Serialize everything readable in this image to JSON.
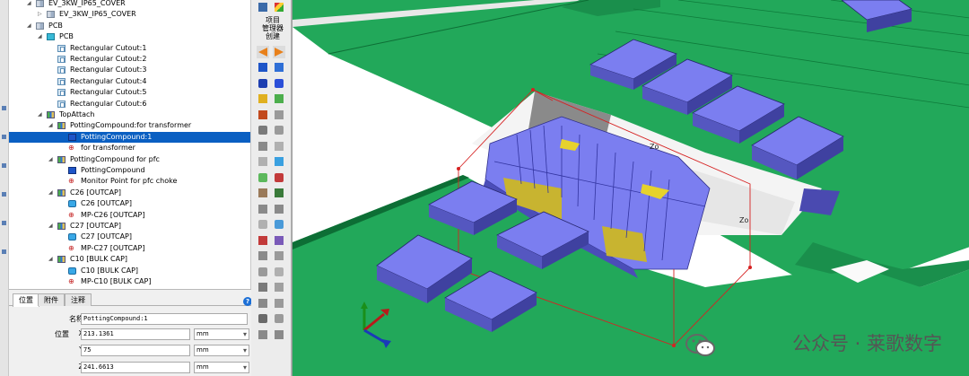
{
  "tree": [
    {
      "label": "EV_3KW_IP65_COVER",
      "indent": 3,
      "tw": "−",
      "icon": "asm",
      "selected": false
    },
    {
      "label": "EV_3KW_IP65_COVER",
      "indent": 4,
      "tw": "+",
      "icon": "asm",
      "selected": false
    },
    {
      "label": "PCB",
      "indent": 3,
      "tw": "−",
      "icon": "asm",
      "selected": false
    },
    {
      "label": "PCB",
      "indent": 4,
      "tw": "−",
      "icon": "pcb",
      "selected": false
    },
    {
      "label": "Rectangular Cutout:1",
      "indent": 5,
      "tw": "",
      "icon": "cut",
      "selected": false
    },
    {
      "label": "Rectangular Cutout:2",
      "indent": 5,
      "tw": "",
      "icon": "cut",
      "selected": false
    },
    {
      "label": "Rectangular Cutout:3",
      "indent": 5,
      "tw": "",
      "icon": "cut",
      "selected": false
    },
    {
      "label": "Rectangular Cutout:4",
      "indent": 5,
      "tw": "",
      "icon": "cut",
      "selected": false
    },
    {
      "label": "Rectangular Cutout:5",
      "indent": 5,
      "tw": "",
      "icon": "cut",
      "selected": false
    },
    {
      "label": "Rectangular Cutout:6",
      "indent": 5,
      "tw": "",
      "icon": "cut",
      "selected": false
    },
    {
      "label": "TopAttach",
      "indent": 4,
      "tw": "−",
      "icon": "grp",
      "selected": false
    },
    {
      "label": "PottingCompound:for transformer",
      "indent": 5,
      "tw": "−",
      "icon": "grp",
      "selected": false
    },
    {
      "label": "PottingCompound:1",
      "indent": 6,
      "tw": "",
      "icon": "pot",
      "selected": true
    },
    {
      "label": "for transformer",
      "indent": 6,
      "tw": "",
      "icon": "mp",
      "selected": false
    },
    {
      "label": "PottingCompound for pfc",
      "indent": 5,
      "tw": "−",
      "icon": "grp",
      "selected": false
    },
    {
      "label": "PottingCompound",
      "indent": 6,
      "tw": "",
      "icon": "pot",
      "selected": false
    },
    {
      "label": "Monitor Point for pfc choke",
      "indent": 6,
      "tw": "",
      "icon": "mp",
      "selected": false
    },
    {
      "label": "C26 [OUTCAP]",
      "indent": 5,
      "tw": "−",
      "icon": "grp",
      "selected": false
    },
    {
      "label": "C26 [OUTCAP]",
      "indent": 6,
      "tw": "",
      "icon": "cap",
      "selected": false
    },
    {
      "label": "MP-C26 [OUTCAP]",
      "indent": 6,
      "tw": "",
      "icon": "mp",
      "selected": false
    },
    {
      "label": "C27 [OUTCAP]",
      "indent": 5,
      "tw": "−",
      "icon": "grp",
      "selected": false
    },
    {
      "label": "C27 [OUTCAP]",
      "indent": 6,
      "tw": "",
      "icon": "cap",
      "selected": false
    },
    {
      "label": "MP-C27 [OUTCAP]",
      "indent": 6,
      "tw": "",
      "icon": "mp",
      "selected": false
    },
    {
      "label": "C10 [BULK CAP]",
      "indent": 5,
      "tw": "−",
      "icon": "grp",
      "selected": false
    },
    {
      "label": "C10 [BULK CAP]",
      "indent": 6,
      "tw": "",
      "icon": "cap",
      "selected": false
    },
    {
      "label": "MP-C10 [BULK CAP]",
      "indent": 6,
      "tw": "",
      "icon": "mp",
      "selected": false
    }
  ],
  "tabs": [
    {
      "label": "位置",
      "active": true
    },
    {
      "label": "附件",
      "active": false
    },
    {
      "label": "注释",
      "active": false
    }
  ],
  "props": {
    "name_label": "名称",
    "name_value": "PottingCompound:1",
    "position_label": "位置",
    "x_axis": "X",
    "y_axis": "Y",
    "z_axis": "Z",
    "x_value": "213.1361",
    "y_value": "75",
    "z_value": "241.6613",
    "unit": "mm",
    "help": "?"
  },
  "toolbar": {
    "title": "项目\n管理器\n创建"
  },
  "watermark": "公众号 · 莱歌数字",
  "colors": {
    "board": "#1fa85a",
    "board_dark": "#0d6e35",
    "component": "#7b7ef0",
    "component_side": "#5557c0",
    "selection": "#0a5fc2"
  }
}
